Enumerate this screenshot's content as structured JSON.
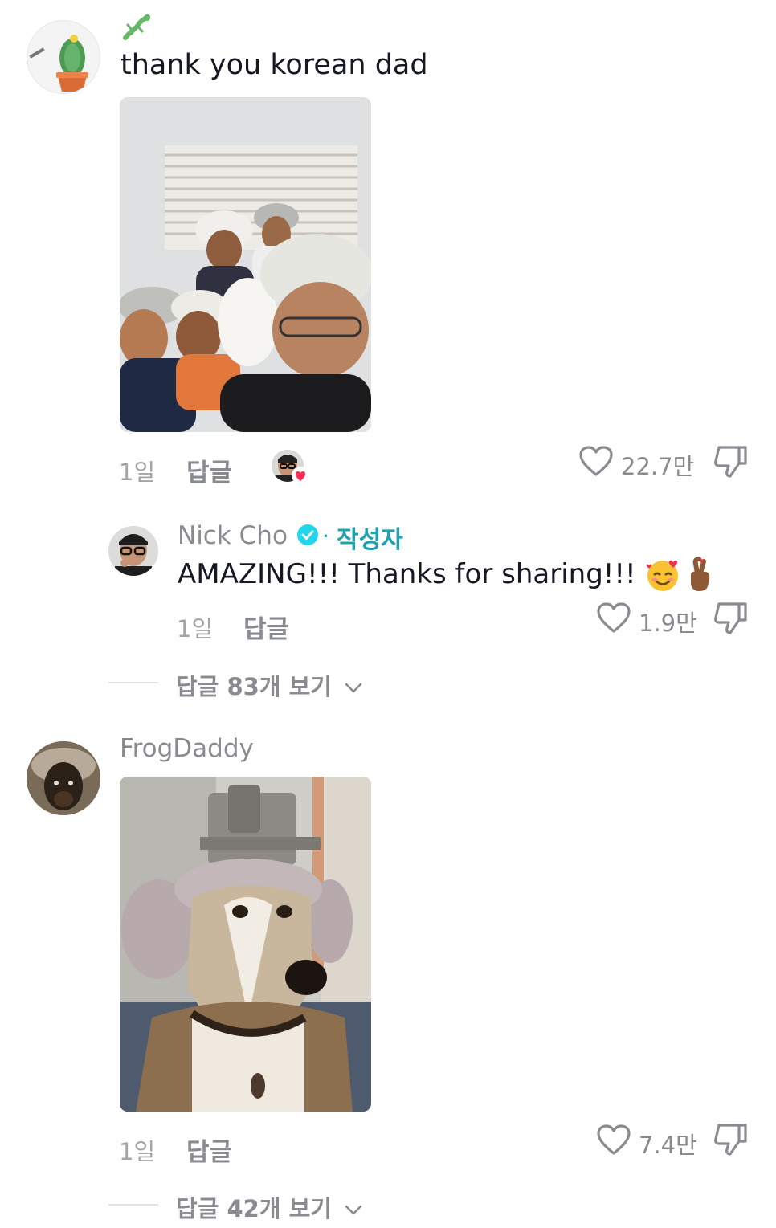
{
  "comments": [
    {
      "text": "thank you korean dad",
      "date": "1일",
      "reply_label": "답글",
      "likes": "22.7만",
      "reply": {
        "username": "Nick Cho",
        "author_label": "작성자",
        "separator": "·",
        "text": "AMAZING!!! Thanks for sharing!!!",
        "date": "1일",
        "reply_label": "답글",
        "likes": "1.9만"
      },
      "view_replies": "답글 83개 보기"
    },
    {
      "username": "FrogDaddy",
      "date": "1일",
      "reply_label": "답글",
      "likes": "7.4만",
      "view_replies": "답글 42개 보기"
    }
  ],
  "colors": {
    "text": "#161823",
    "muted": "#8a8b91",
    "author_accent": "#20a0b0",
    "verified": "#20d5ec",
    "heart_badge": "#fe2c55"
  }
}
